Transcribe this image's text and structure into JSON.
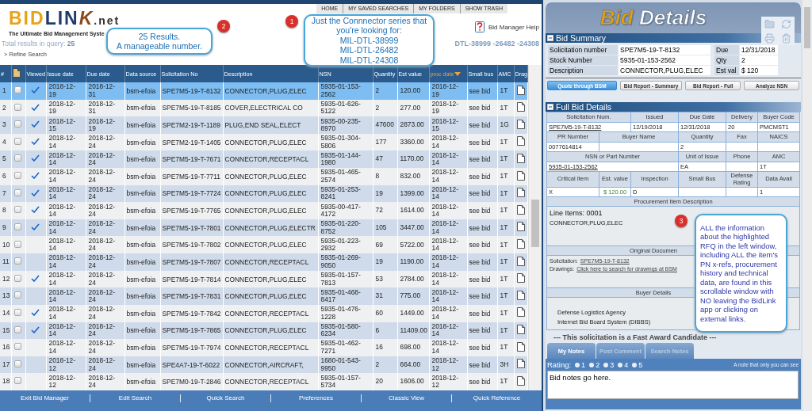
{
  "top_nav": [
    "HOME",
    "MY SAVED SEARCHES",
    "MY FOLDERS",
    "SHOW TRASH"
  ],
  "logo": {
    "parts": [
      "BID",
      "LIN",
      "K",
      ".net"
    ],
    "tagline": "The Ultimate Bid Management Syste"
  },
  "help_link": "Bid Manager Help",
  "results": "Total results in query: **25**",
  "refine": "> Refine Search",
  "series_filter": "DTL-38999 -26482 -24308",
  "table": {
    "columns": [
      {
        "kind": "text",
        "label": "#",
        "sorted": false
      },
      {
        "kind": "checkbox",
        "sorted": false
      },
      {
        "kind": "viewed",
        "label": "Viewed",
        "sorted": false
      },
      {
        "kind": "text",
        "label": "Issue date",
        "sorted": false
      },
      {
        "kind": "text",
        "label": "Due date",
        "sorted": false
      },
      {
        "kind": "text",
        "label": "Data source",
        "sorted": false
      },
      {
        "kind": "text",
        "label": "Solicitation No",
        "sorted": false
      },
      {
        "kind": "text",
        "label": "Description",
        "sorted": false
      },
      {
        "kind": "text",
        "label": "NSN",
        "sorted": false
      },
      {
        "kind": "text",
        "label": "Quantity",
        "sorted": false
      },
      {
        "kind": "text",
        "label": "Est value",
        "sorted": false
      },
      {
        "kind": "text",
        "label": "proc date",
        "sorted": true
      },
      {
        "kind": "text",
        "label": "Small bus",
        "sorted": false
      },
      {
        "kind": "text",
        "label": "AMC",
        "sorted": false
      },
      {
        "kind": "drag",
        "label": "Drag",
        "sorted": false
      }
    ],
    "rows": [
      {
        "selected": true,
        "checked": false,
        "viewed": true,
        "cells": [
          "1",
          "",
          "",
          "2018-12-19",
          "2018-12-31",
          "bsm-efoia",
          "SPE7M5-19-T-8132",
          "CONNECTOR,PLUG,ELEC",
          "5935-01-153-2562",
          "2",
          "120.00",
          "2018-12-19",
          "see bid",
          "1T",
          ""
        ]
      },
      {
        "selected": false,
        "checked": false,
        "viewed": true,
        "cells": [
          "2",
          "",
          "",
          "2018-12-19",
          "2018-12-31",
          "bsm-efoia",
          "SPE7M5-19-T-8185",
          "COVER,ELECTRICAL CO",
          "5935-01-626-5122",
          "2",
          "277.00",
          "2018-12-19",
          "see bid",
          "1T",
          ""
        ]
      },
      {
        "selected": false,
        "checked": false,
        "viewed": true,
        "cells": [
          "3",
          "",
          "",
          "2018-12-15",
          "2018-12-19",
          "bsm-efoia",
          "SPE7M2-19-T-1189",
          "PLUG,END SEAL,ELECT",
          "5935-00-235-8970",
          "47600",
          "2873.00",
          "2018-12-15",
          "see bid",
          "1G",
          ""
        ]
      },
      {
        "selected": false,
        "checked": false,
        "viewed": true,
        "cells": [
          "4",
          "",
          "",
          "2018-12-14",
          "2018-12-24",
          "bsm-efoia",
          "SPE7M2-19-T-1405",
          "CONNECTOR,PLUG,ELEC",
          "5935-01-304-5806",
          "177",
          "3360.00",
          "2018-12-14",
          "see bid",
          "1T",
          ""
        ]
      },
      {
        "selected": false,
        "checked": false,
        "viewed": true,
        "cells": [
          "5",
          "",
          "",
          "2018-12-14",
          "2018-12-24",
          "bsm-efoia",
          "SPE7M5-19-T-7671",
          "CONNECTOR,RECEPTACL",
          "5935-01-144-1980",
          "47",
          "1170.00",
          "2018-12-14",
          "see bid",
          "1T",
          ""
        ]
      },
      {
        "selected": false,
        "checked": false,
        "viewed": true,
        "cells": [
          "6",
          "",
          "",
          "2018-12-14",
          "2018-12-24",
          "bsm-efoia",
          "SPE7M5-19-T-7711",
          "CONNECTOR,PLUG,ELEC",
          "5935-01-465-2574",
          "8",
          "832.00",
          "2018-12-14",
          "see bid",
          "1T",
          ""
        ]
      },
      {
        "selected": false,
        "checked": false,
        "viewed": true,
        "cells": [
          "7",
          "",
          "",
          "2018-12-14",
          "2018-12-24",
          "bsm-efoia",
          "SPE7M5-19-T-7724",
          "CONNECTOR,PLUG,ELEC",
          "5935-01-253-8241",
          "19",
          "1399.00",
          "2018-12-14",
          "see bid",
          "1T",
          ""
        ]
      },
      {
        "selected": false,
        "checked": false,
        "viewed": true,
        "cells": [
          "8",
          "",
          "",
          "2018-12-14",
          "2018-12-24",
          "bsm-efoia",
          "SPE7M5-19-T-7765",
          "CONNECTOR,PLUG,ELEC",
          "5935-00-417-4172",
          "72",
          "1614.00",
          "2018-12-14",
          "see bid",
          "1T",
          ""
        ]
      },
      {
        "selected": false,
        "checked": false,
        "viewed": true,
        "cells": [
          "9",
          "",
          "",
          "2018-12-14",
          "2018-12-24",
          "bsm-efoia",
          "SPE7M5-19-T-7801",
          "CONNECTOR,PLUG,ELECTR",
          "5935-01-220-8752",
          "105",
          "3447.00",
          "2018-12-14",
          "see bid",
          "1T",
          ""
        ]
      },
      {
        "selected": false,
        "checked": false,
        "viewed": false,
        "cells": [
          "10",
          "",
          "",
          "2018-12-14",
          "2018-12-24",
          "bsm-efoia",
          "SPE7M5-19-T-7802",
          "CONNECTOR,PLUG,ELEC",
          "5935-01-223-2932",
          "69",
          "5722.00",
          "2018-12-14",
          "see bid",
          "1T",
          ""
        ]
      },
      {
        "selected": false,
        "checked": false,
        "viewed": false,
        "cells": [
          "11",
          "",
          "",
          "2018-12-14",
          "2018-12-24",
          "bsm-efoia",
          "SPE7M5-19-T-7807",
          "CONNECTOR,RECEPTACL",
          "5935-01-269-9050",
          "19",
          "1190.00",
          "2018-12-14",
          "see bid",
          "1T",
          ""
        ]
      },
      {
        "selected": false,
        "checked": false,
        "viewed": true,
        "cells": [
          "12",
          "",
          "",
          "2018-12-14",
          "2018-12-24",
          "bsm-efoia",
          "SPE7M5-19-T-7814",
          "CONNECTOR,PLUG,ELEC",
          "5935-01-157-7813",
          "53",
          "2784.00",
          "2018-12-14",
          "see bid",
          "1T",
          ""
        ]
      },
      {
        "selected": false,
        "checked": false,
        "viewed": false,
        "cells": [
          "13",
          "",
          "",
          "2018-12-14",
          "2018-12-24",
          "bsm-efoia",
          "SPE7M5-19-T-7831",
          "CONNECTOR,PLUG,ELEC",
          "5935-01-468-8417",
          "31",
          "775.00",
          "2018-12-14",
          "see bid",
          "1T",
          ""
        ]
      },
      {
        "selected": false,
        "checked": false,
        "viewed": true,
        "cells": [
          "14",
          "",
          "",
          "2018-12-14",
          "2018-12-24",
          "bsm-efoia",
          "SPE7M5-19-T-7842",
          "CONNECTOR,RECEPTACL",
          "5935-01-476-1228",
          "60",
          "1449.00",
          "2018-12-14",
          "see bid",
          "1T",
          ""
        ]
      },
      {
        "selected": false,
        "checked": false,
        "viewed": true,
        "cells": [
          "15",
          "",
          "",
          "2018-12-14",
          "2018-12-24",
          "bsm-efoia",
          "SPE7M5-19-T-7865",
          "CONNECTOR,PLUG,ELEC",
          "5935-01-580-6234",
          "6",
          "11409.00",
          "2018-12-14",
          "see bid",
          "1T",
          ""
        ]
      },
      {
        "selected": false,
        "checked": false,
        "viewed": false,
        "cells": [
          "16",
          "",
          "",
          "2018-12-14",
          "2018-12-24",
          "bsm-efoia",
          "SPE7M5-19-T-7974",
          "CONNECTOR,RECEPTACL",
          "5935-01-462-7271",
          "16",
          "698.00",
          "2018-12-14",
          "see bid",
          "1T",
          ""
        ]
      },
      {
        "selected": false,
        "checked": false,
        "viewed": false,
        "cells": [
          "17",
          "",
          "",
          "2018-12-12",
          "2018-12-24",
          "bsm-efoia",
          "SPE4A7-19-T-6022",
          "CONNECTOR,AIRCRAFT,",
          "1680-01-543-9950",
          "2",
          "664.00",
          "2018-12-12",
          "see bid",
          "3H",
          ""
        ]
      },
      {
        "selected": false,
        "checked": false,
        "viewed": false,
        "cells": [
          "18",
          "",
          "",
          "2018-12-12",
          "2018-12-24",
          "bsm-efoia",
          "SPE7M0-19-T-2846",
          "CONNECTOR,RECEPTACL",
          "5935-01-157-5734",
          "20",
          "1606.00",
          "2018-12-12",
          "see bid",
          "1T",
          ""
        ]
      }
    ]
  },
  "footer_links": [
    "Exit Bid Manager",
    "Edit Search",
    "Quick Search",
    "Preferences",
    "Classic View",
    "Quick Reference"
  ],
  "callouts": [
    {
      "badge": "2",
      "lines": [
        "25 Results.",
        "A manageable number."
      ]
    },
    {
      "badge": "1",
      "lines": [
        "Just the Connnector series that you're looking for:",
        "MIL-DTL-38999",
        "MIL-DTL-26482",
        "MIL-DTL-24308"
      ]
    },
    {
      "badge": "3",
      "lines": [
        "ALL the information about the highlighted RFQ in the left window, including ALL the item's PN x-refs, procurement history and technical data, are found in this scrollable window with NO leaving the BidLink app or clicking on external links."
      ]
    }
  ],
  "details": {
    "title": [
      "Bid",
      "Details"
    ],
    "summary": {
      "heading": "Bid Summary",
      "rows": [
        {
          "label": "Solicitation number",
          "value": "SPE7M5-19-T-8132",
          "label2": "Due",
          "value2": "12/31/2018"
        },
        {
          "label": "Stock Number",
          "value": "5935-01-153-2562",
          "label2": "Qty",
          "value2": "2"
        },
        {
          "label": "Description",
          "value": "CONNECTOR,PLUG,ELEC",
          "label2": "Est val",
          "value2": "$ 120"
        }
      ]
    },
    "buttons": [
      {
        "label": "Quote through BSM",
        "primary": true
      },
      {
        "label": "Bid Report - Summary",
        "primary": false
      },
      {
        "label": "Bid Report - Full",
        "primary": false
      },
      {
        "label": "Analyze NSN",
        "primary": false
      }
    ],
    "full": {
      "heading": "Full Bid Details",
      "grid": [
        {
          "headers": [
            "Solicitation Num.",
            "Issued",
            "Due Date",
            "Delivery",
            "Buyer Code"
          ],
          "values": [
            {
              "kind": "link",
              "text": "SPE7M5-19-T-8132"
            },
            {
              "kind": "text",
              "text": "12/19/2018"
            },
            {
              "kind": "text",
              "text": "12/31/2018"
            },
            {
              "kind": "text",
              "text": "20"
            },
            {
              "kind": "text",
              "text": "PMCMST1"
            }
          ]
        },
        {
          "headers": [
            "PR Number",
            "Buyer Name",
            "Quantity",
            "Fax",
            "NAICS"
          ],
          "values": [
            {
              "kind": "text",
              "text": "0077614814"
            },
            {
              "kind": "blank"
            },
            {
              "kind": "text",
              "text": "2"
            },
            {
              "kind": "blank"
            },
            {
              "kind": "blank"
            }
          ]
        },
        {
          "headers": [
            "NSN or Part Number",
            "Unit of Issue",
            "Phone",
            "AMC"
          ],
          "values": [
            {
              "kind": "link",
              "text": "5935-01-153-2562"
            },
            {
              "kind": "text",
              "text": "EA"
            },
            {
              "kind": "blank"
            },
            {
              "kind": "text",
              "text": "1T"
            }
          ]
        },
        {
          "headers": [
            "Critical Item",
            "Est. value",
            "Inspection",
            "Small Bus",
            "Defense Rating",
            "Data Avail"
          ],
          "values": [
            {
              "kind": "text",
              "text": "X"
            },
            {
              "kind": "money",
              "text": "$ 120.00"
            },
            {
              "kind": "text",
              "text": "D"
            },
            {
              "kind": "blank"
            },
            {
              "kind": "blank"
            },
            {
              "kind": "text",
              "text": "1"
            }
          ]
        }
      ],
      "description_heading": "Procurement Item Description",
      "line_items": "Line Items: 0001",
      "item_text": "CONNECTOR,PLUG,ELEC",
      "documents_heading": "Original Documen",
      "documents": [
        {
          "label": "Solicitation:",
          "link": "SPE7M5-19-T-8132"
        },
        {
          "label": "Drawings:",
          "link": "Click here to search for drawings at BSM"
        }
      ],
      "buyer_heading": "Buyer Details",
      "buyer_lines": [
        "Defense Logistics Agency",
        "Internet Bid Board System (DIBBS)"
      ],
      "fast_award": "--- This solicitation is a Fast Award Candidate ---"
    },
    "notes": {
      "tabs": [
        {
          "label": "My Notes",
          "selected": true
        },
        {
          "label": "Post Comment",
          "selected": false
        },
        {
          "label": "Search Notes",
          "selected": false
        }
      ],
      "rating_label": "Rating:",
      "ratings": [
        {
          "label": "1",
          "selected": false
        },
        {
          "label": "2",
          "selected": false
        },
        {
          "label": "3",
          "selected": false
        },
        {
          "label": "4",
          "selected": false
        },
        {
          "label": "5",
          "selected": false
        }
      ],
      "hint": "A note that only you can see",
      "value": "Bid notes go here."
    }
  }
}
